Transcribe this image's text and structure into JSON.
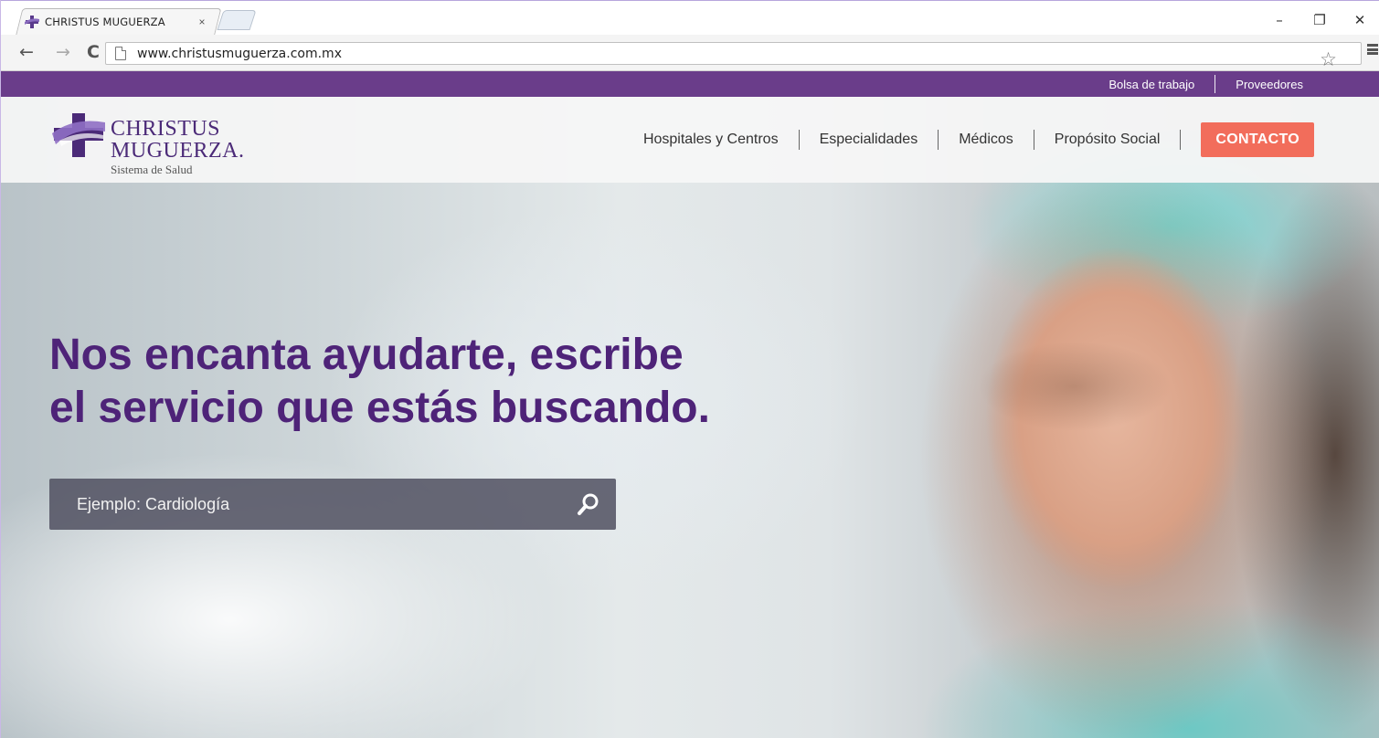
{
  "browser": {
    "tab_title": "CHRISTUS MUGUERZA",
    "tab_close": "×",
    "url": "www.christusmuguerza.com.mx",
    "controls": {
      "minimize": "–",
      "restore": "❐",
      "close": "✕"
    },
    "nav": {
      "back": "←",
      "forward": "→",
      "reload": "C"
    },
    "star": "☆"
  },
  "topbar": {
    "links": [
      "Bolsa de trabajo",
      "Proveedores"
    ],
    "color": "#6a3d8a"
  },
  "header": {
    "logo": {
      "line1": "CHRISTUS",
      "line2": "MUGUERZA.",
      "tagline": "Sistema de Salud"
    },
    "nav": [
      "Hospitales y Centros",
      "Especialidades",
      "Médicos",
      "Propósito Social"
    ],
    "contact_label": "CONTACTO",
    "contact_color": "#f26d5b"
  },
  "hero": {
    "headline_line1": "Nos encanta ayudarte, escribe",
    "headline_line2": "el servicio que estás buscando.",
    "headline_color": "#4e2378",
    "search_placeholder": "Ejemplo: Cardiología",
    "search_icon": "search-icon"
  }
}
